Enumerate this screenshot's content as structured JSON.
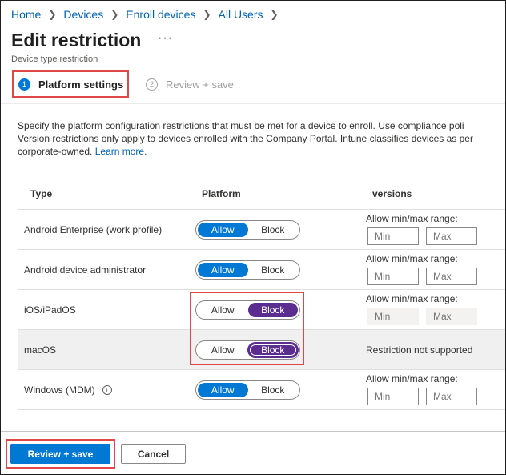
{
  "breadcrumb": [
    {
      "label": "Home"
    },
    {
      "label": "Devices"
    },
    {
      "label": "Enroll devices"
    },
    {
      "label": "All Users"
    }
  ],
  "header": {
    "title": "Edit restriction",
    "more": "···",
    "subtitle": "Device type restriction"
  },
  "wizard": {
    "steps": [
      {
        "number": "1",
        "label": "Platform settings",
        "active": true
      },
      {
        "number": "2",
        "label": "Review + save",
        "active": false
      }
    ]
  },
  "description": {
    "line1": "Specify the platform configuration restrictions that must be met for a device to enroll. Use compliance poli",
    "line2": "Version restrictions only apply to devices enrolled with the Company Portal. Intune classifies devices as per",
    "line3": "corporate-owned.",
    "learn_more": "Learn more."
  },
  "table": {
    "headers": {
      "type": "Type",
      "platform": "Platform",
      "versions": "versions"
    },
    "allow_label": "Allow",
    "block_label": "Block",
    "range_label": "Allow min/max range:",
    "min_placeholder": "Min",
    "max_placeholder": "Max",
    "rows": [
      {
        "type": "Android Enterprise (work profile)",
        "state": "Allow",
        "versions": "range"
      },
      {
        "type": "Android device administrator",
        "state": "Allow",
        "versions": "range"
      },
      {
        "type": "iOS/iPadOS",
        "state": "Block",
        "versions": "range-disabled"
      },
      {
        "type": "macOS",
        "state": "Block",
        "versions": "not-supported",
        "not_supported_text": "Restriction not supported"
      },
      {
        "type": "Windows (MDM)",
        "state": "Allow",
        "versions": "range",
        "info_icon": "info-icon"
      }
    ]
  },
  "footer": {
    "primary_label": "Review + save",
    "secondary_label": "Cancel"
  },
  "colors": {
    "accent": "#0078d4",
    "block": "#5c2d91",
    "annotation": "#e04848"
  }
}
